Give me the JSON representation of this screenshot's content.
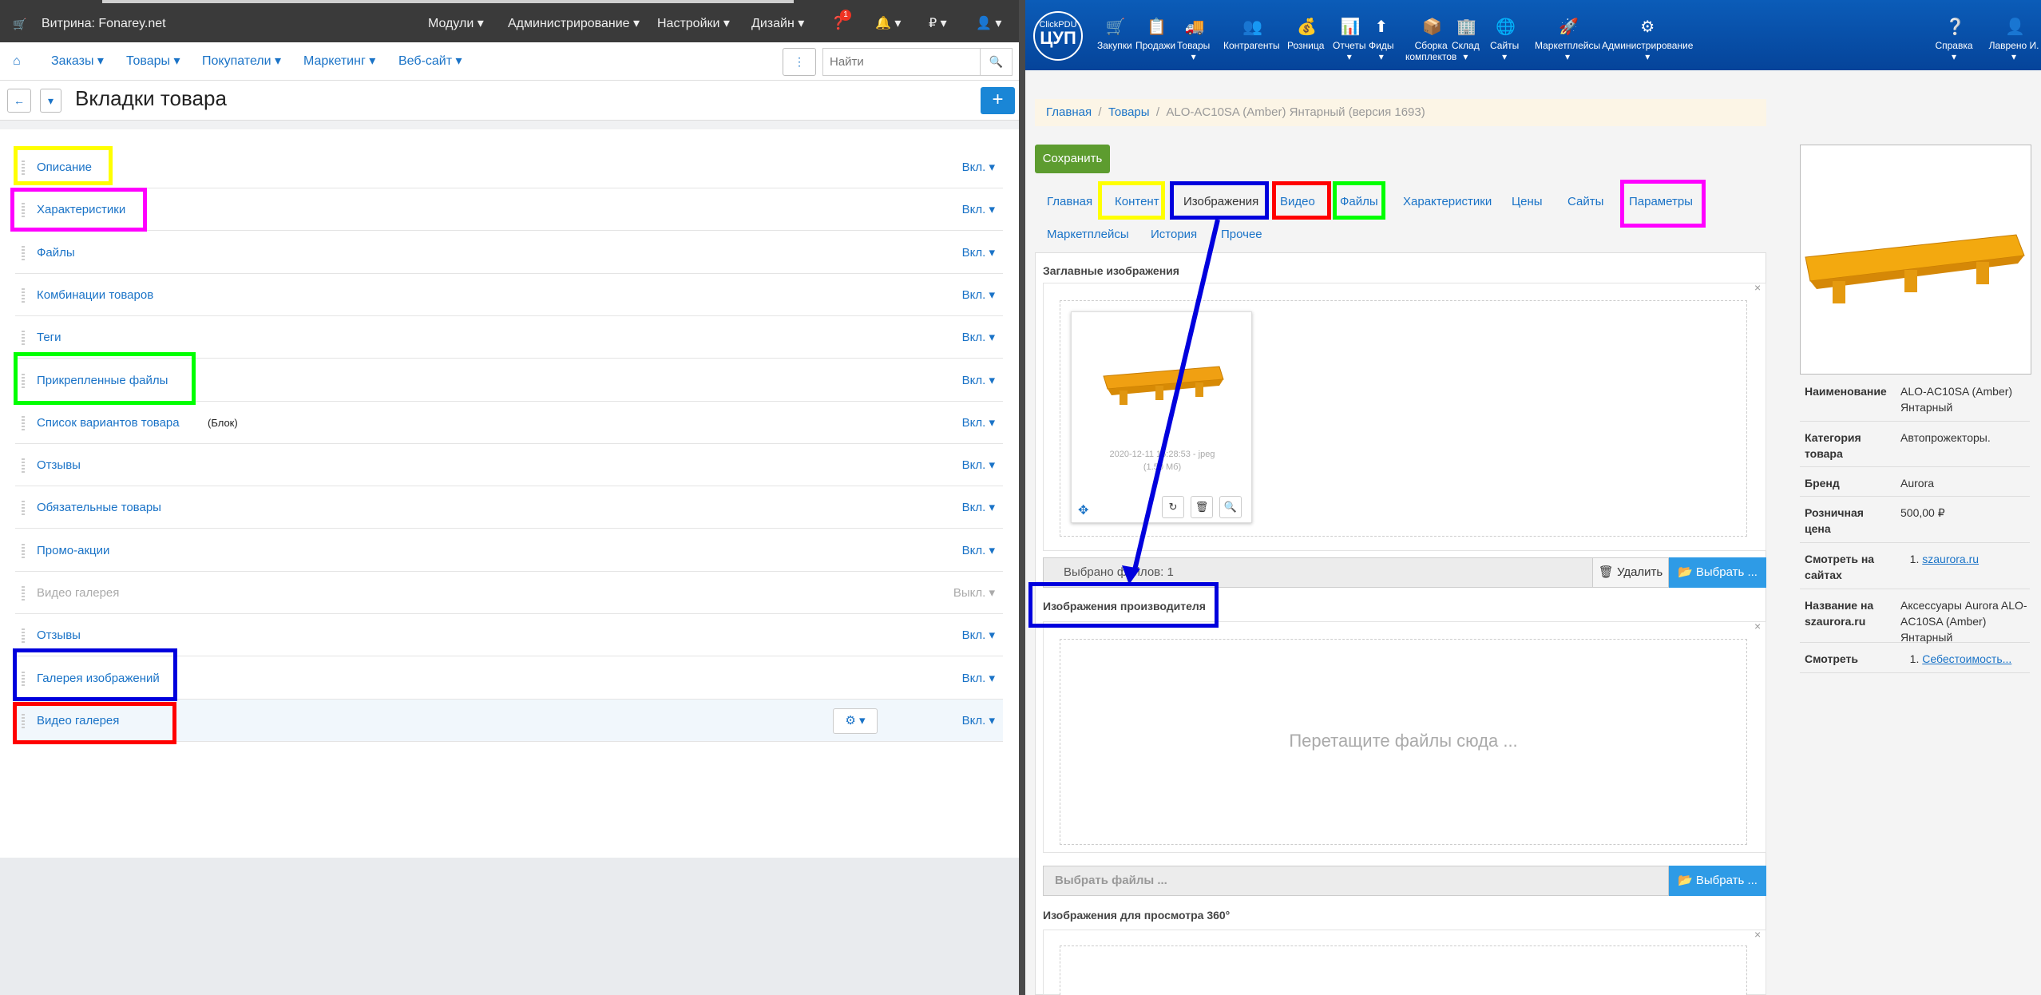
{
  "left": {
    "store_label": "Витрина: Fonarey.net",
    "top_menu": [
      "Модули",
      "Администрирование",
      "Настройки",
      "Дизайн"
    ],
    "notif_badge": "1",
    "currency_symbol": "₽",
    "nav": [
      "Заказы",
      "Товары",
      "Покупатели",
      "Маркетинг",
      "Веб-сайт"
    ],
    "search_placeholder": "Найти",
    "page_title": "Вкладки товара",
    "add_label": "+",
    "rows": [
      {
        "label": "Описание",
        "status": "Вкл.",
        "enabled": true
      },
      {
        "label": "Характеристики",
        "status": "Вкл.",
        "enabled": true
      },
      {
        "label": "Файлы",
        "status": "Вкл.",
        "enabled": true
      },
      {
        "label": "Комбинации товаров",
        "status": "Вкл.",
        "enabled": true
      },
      {
        "label": "Теги",
        "status": "Вкл.",
        "enabled": true
      },
      {
        "label": "Прикрепленные файлы",
        "status": "Вкл.",
        "enabled": true
      },
      {
        "label": "Список вариантов товара",
        "suffix": "(Блок)",
        "status": "Вкл.",
        "enabled": true
      },
      {
        "label": "Отзывы",
        "status": "Вкл.",
        "enabled": true
      },
      {
        "label": "Обязательные товары",
        "status": "Вкл.",
        "enabled": true
      },
      {
        "label": "Промо-акции",
        "status": "Вкл.",
        "enabled": true
      },
      {
        "label": "Видео галерея",
        "status": "Выкл.",
        "enabled": false
      },
      {
        "label": "Отзывы",
        "status": "Вкл.",
        "enabled": true
      },
      {
        "label": "Галерея изображений",
        "status": "Вкл.",
        "enabled": true
      },
      {
        "label": "Видео галерея",
        "status": "Вкл.",
        "enabled": true
      }
    ]
  },
  "right": {
    "logo_top": "ClickPDU",
    "logo_main": "ЦУП",
    "menu": [
      "Закупки",
      "Продажи",
      "Товары",
      "Контрагенты",
      "Розница",
      "Отчеты",
      "Фиды",
      "Сборка",
      "Склад",
      "Сайты",
      "Маркетплейсы",
      "Администрирование"
    ],
    "menu_sub": "комплектов",
    "help_label": "Справка",
    "user_label": "Лаврено И.",
    "breadcrumb": {
      "home": "Главная",
      "section": "Товары",
      "current": "ALO-AC10SA (Amber) Янтарный (версия 1693)"
    },
    "save_label": "Сохранить",
    "tabs_row1": [
      "Главная",
      "Контент",
      "Изображения",
      "Видео",
      "Файлы",
      "Характеристики",
      "Цены",
      "Сайты",
      "Параметры"
    ],
    "tabs_row2": [
      "Маркетплейсы",
      "История",
      "Прочее"
    ],
    "active_tab": "Изображения",
    "section_main": "Заглавные изображения",
    "thumb_caption_1": "2020-12-11 16:28:53 - jpeg",
    "thumb_caption_2": "(1.50 Мб)",
    "selected_files": "Выбрано файлов: 1",
    "delete_label": "Удалить",
    "choose_label": "Выбрать ...",
    "section_manufacturer": "Изображения производителя",
    "drop_hint": "Перетащите файлы сюда ...",
    "choose_files_placeholder": "Выбрать файлы ...",
    "section_360": "Изображения для просмотра 360°",
    "close_x": "×",
    "props": [
      {
        "k": "Наименование",
        "v": "ALO-AC10SA (Amber) Янтарный"
      },
      {
        "k": "Категория товара",
        "v": "Автопрожекторы."
      },
      {
        "k": "Бренд",
        "v": "Aurora"
      },
      {
        "k": "Розничная цена",
        "v": "500,00 ₽"
      },
      {
        "k": "Смотреть на сайтах",
        "v": "1.",
        "link": "szaurora.ru"
      },
      {
        "k": "Название на szaurora.ru",
        "v": "Аксессуары Aurora ALO-AC10SA (Amber) Янтарный"
      },
      {
        "k": "Смотреть",
        "v": "1.",
        "link": "Себестоимость..."
      }
    ]
  },
  "colors": {
    "highlight_yellow": "#ffff00",
    "highlight_magenta": "#ff00ff",
    "highlight_green": "#00ff00",
    "highlight_blue": "#0000dd",
    "highlight_red": "#ff0000",
    "link_blue": "#1a73c7",
    "top_blue": "#0b5cb8",
    "save_green": "#5d9c2f"
  }
}
